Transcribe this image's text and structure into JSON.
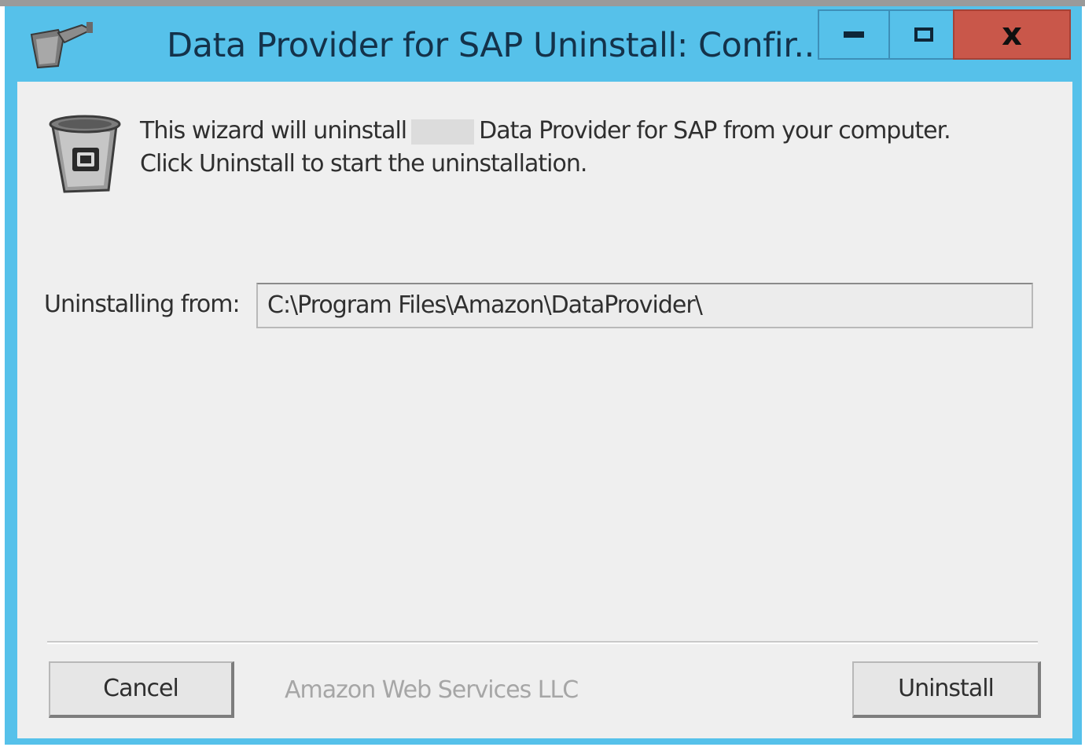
{
  "window": {
    "title": "Data Provider for SAP Uninstall: Confir...",
    "accent_color": "#56c1ea",
    "close_color": "#c9574a",
    "controls": {
      "minimize_icon": "minimize-icon",
      "maximize_icon": "maximize-icon",
      "close_icon": "close-icon",
      "close_glyph": "x"
    }
  },
  "content": {
    "message_line1_prefix": "This wizard will uninstall",
    "message_line1_suffix": "Data Provider for SAP from your computer.",
    "message_line2": "Click Uninstall to start the uninstallation.",
    "icon": "trash-can-icon",
    "uninstalling_from_label": "Uninstalling from:",
    "uninstalling_from_value": "C:\\Program Files\\Amazon\\DataProvider\\"
  },
  "footer": {
    "cancel_label": "Cancel",
    "vendor": "Amazon Web Services LLC",
    "uninstall_label": "Uninstall"
  }
}
